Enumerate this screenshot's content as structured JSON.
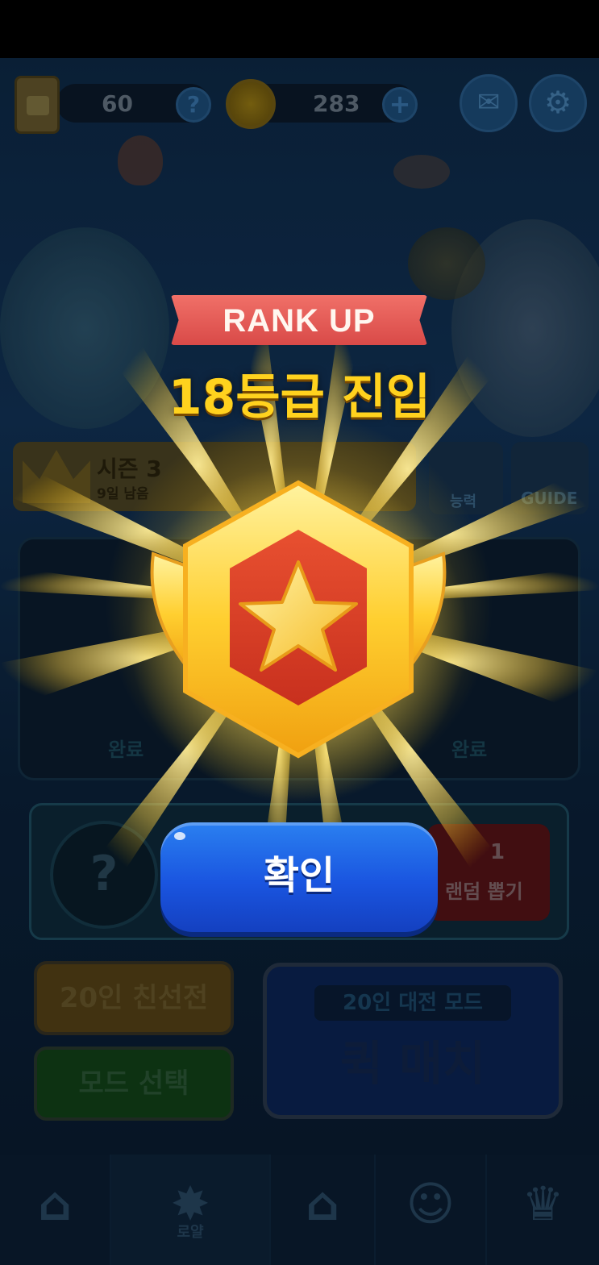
{
  "topbar": {
    "tickets": "60",
    "coins": "283"
  },
  "season": {
    "title": "시즌 3",
    "days_left": "9일 남음",
    "skill_label": "능력",
    "guide_label": "GUIDE"
  },
  "missions": {
    "status_1": "완료",
    "status_2": "완료"
  },
  "gacha": {
    "count": "1",
    "label": "랜덤 뽑기"
  },
  "modes": {
    "friendly": "20인 친선전",
    "mode_select": "모드 선택",
    "quick_sub": "20인 대전 모드",
    "quick_title": "퀵 매치"
  },
  "nav": {
    "royal_label": "로얄"
  },
  "popup": {
    "ribbon": "RANK UP",
    "rank_text": "18등급 진입",
    "confirm_label": "확인"
  },
  "colors": {
    "ribbon": "#d94a48",
    "rank_text": "#ffd21e",
    "confirm_button": "#1a55e0"
  }
}
